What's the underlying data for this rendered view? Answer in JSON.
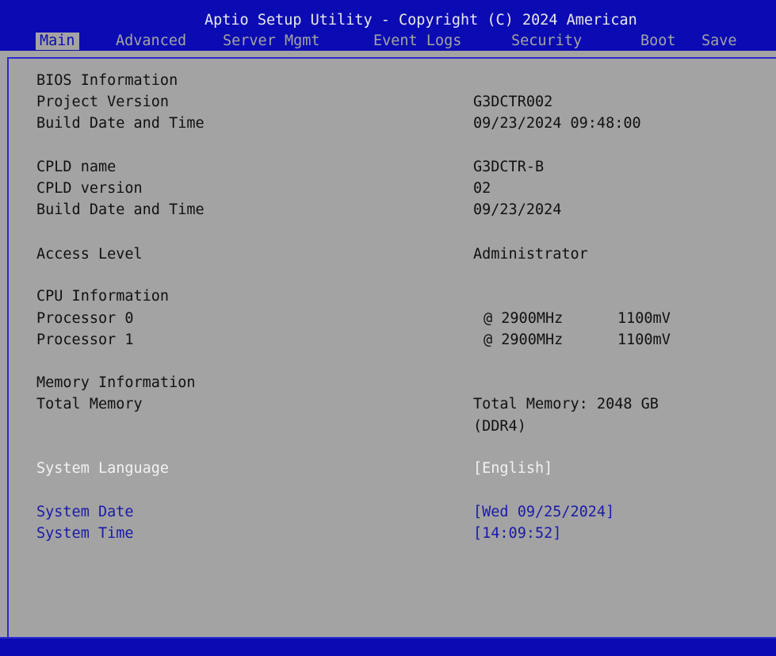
{
  "app": {
    "title": "Aptio Setup Utility - Copyright (C) 2024 American"
  },
  "tabs": [
    {
      "label": "Main",
      "active": true
    },
    {
      "label": "Advanced"
    },
    {
      "label": "Server Mgmt"
    },
    {
      "label": "Event Logs"
    },
    {
      "label": "Security"
    },
    {
      "label": "Boot"
    },
    {
      "label": "Save"
    }
  ],
  "bios": {
    "heading": "BIOS Information",
    "project_version_label": "Project Version",
    "project_version": "G3DCTR002",
    "build_label": "Build Date and Time",
    "build": "09/23/2024 09:48:00"
  },
  "cpld": {
    "name_label": "CPLD name",
    "name": "G3DCTR-B",
    "version_label": "CPLD version",
    "version": "02",
    "build_label": "Build Date and Time",
    "build": "09/23/2024"
  },
  "access": {
    "label": "Access Level",
    "value": "Administrator"
  },
  "cpu": {
    "heading": "CPU Information",
    "proc0_label": "Processor 0",
    "proc0_freq": "@ 2900MHz",
    "proc0_volt": "1100mV",
    "proc1_label": "Processor 1",
    "proc1_freq": "@ 2900MHz",
    "proc1_volt": "1100mV"
  },
  "memory": {
    "heading": "Memory Information",
    "total_label": "Total Memory",
    "total_line1": "Total Memory: 2048 GB",
    "total_line2": "(DDR4)"
  },
  "settings": {
    "language_label": "System Language",
    "language_value": "[English]",
    "date_label": "System Date",
    "date_value": "[Wed 09/25/2024]",
    "time_label": "System Time",
    "time_value": "[14:09:52]"
  },
  "colors": {
    "header_bg": "#0b0bb3",
    "panel_bg": "#a3a3a3",
    "selected_text": "#f2f2f2",
    "editable_text": "#1a1aa8"
  }
}
